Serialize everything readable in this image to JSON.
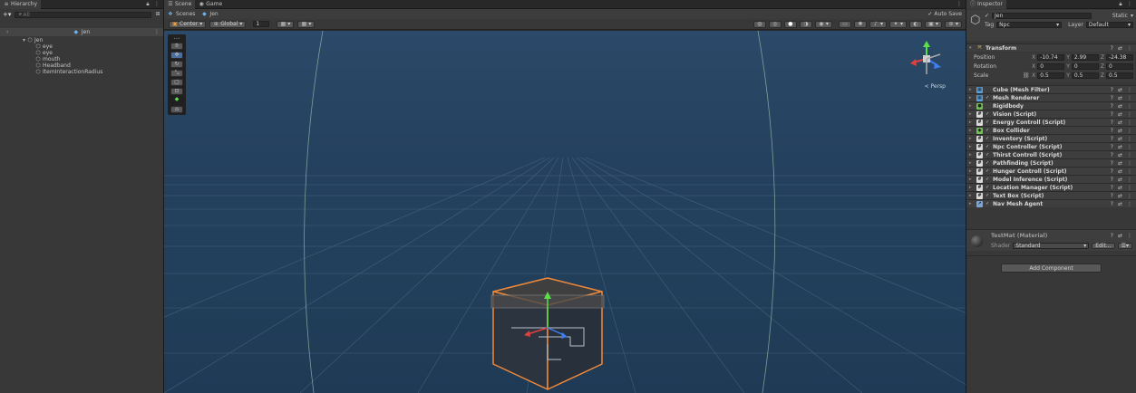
{
  "hierarchy": {
    "tab_title": "Hierarchy",
    "search_placeholder": "All",
    "scene_name": "Jen",
    "root": "Jen",
    "children": [
      "eye",
      "eye",
      "mouth",
      "Headband",
      "ItemInteractionRadius"
    ]
  },
  "scene_tabs": {
    "scene": "Scene",
    "game": "Game",
    "breadcrumb_scenes": "Scenes",
    "breadcrumb_object": "Jen",
    "auto_save": "Auto Save"
  },
  "scene_toolbar": {
    "pivot": "Center",
    "space": "Global",
    "snap_value": "1",
    "persp_label": "< Persp"
  },
  "inspector": {
    "tab_title": "Inspector",
    "object_name": "Jen",
    "static_label": "Static",
    "tag_label": "Tag",
    "tag_value": "Npc",
    "layer_label": "Layer",
    "layer_value": "Default",
    "transform": {
      "title": "Transform",
      "position_label": "Position",
      "rotation_label": "Rotation",
      "scale_label": "Scale",
      "position": {
        "x": "-10.74",
        "y": "2.99",
        "z": "-24.38"
      },
      "rotation": {
        "x": "0",
        "y": "0",
        "z": "0"
      },
      "scale": {
        "x": "0.5",
        "y": "0.5",
        "z": "0.5"
      }
    },
    "components": [
      {
        "name": "Cube (Mesh Filter)",
        "icon": "mesh-filter-icon",
        "color": "#5aa0e0",
        "checkbox": false
      },
      {
        "name": "Mesh Renderer",
        "icon": "mesh-renderer-icon",
        "color": "#5aa0e0",
        "checkbox": true
      },
      {
        "name": "Rigidbody",
        "icon": "rigidbody-icon",
        "color": "#6fc24f",
        "checkbox": false
      },
      {
        "name": "Vision (Script)",
        "icon": "script-icon",
        "color": "#d9d9d9",
        "checkbox": true
      },
      {
        "name": "Energy Controll (Script)",
        "icon": "script-icon",
        "color": "#d9d9d9",
        "checkbox": true
      },
      {
        "name": "Box Collider",
        "icon": "box-collider-icon",
        "color": "#6fc24f",
        "checkbox": true
      },
      {
        "name": "Inventory (Script)",
        "icon": "script-icon",
        "color": "#d9d9d9",
        "checkbox": true
      },
      {
        "name": "Npc Controller (Script)",
        "icon": "script-icon",
        "color": "#d9d9d9",
        "checkbox": true
      },
      {
        "name": "Thirst Controll (Script)",
        "icon": "script-icon",
        "color": "#d9d9d9",
        "checkbox": true
      },
      {
        "name": "Pathfinding (Script)",
        "icon": "script-icon",
        "color": "#d9d9d9",
        "checkbox": true
      },
      {
        "name": "Hunger Controll (Script)",
        "icon": "script-icon",
        "color": "#d9d9d9",
        "checkbox": true
      },
      {
        "name": "Model Inference (Script)",
        "icon": "script-icon",
        "color": "#d9d9d9",
        "checkbox": true
      },
      {
        "name": "Location Manager (Script)",
        "icon": "script-icon",
        "color": "#d9d9d9",
        "checkbox": true
      },
      {
        "name": "Text Box (Script)",
        "icon": "script-icon",
        "color": "#d9d9d9",
        "checkbox": true
      },
      {
        "name": "Nav Mesh Agent",
        "icon": "nav-mesh-agent-icon",
        "color": "#7aa3d6",
        "checkbox": true
      }
    ],
    "material": {
      "name": "TestMat (Material)",
      "shader_label": "Shader",
      "shader_value": "Standard",
      "edit_label": "Edit..."
    },
    "add_component": "Add Component"
  },
  "colors": {
    "scene_bg": "#24405e",
    "selection_outline": "#f08a3a",
    "panel_bg": "#383838"
  }
}
